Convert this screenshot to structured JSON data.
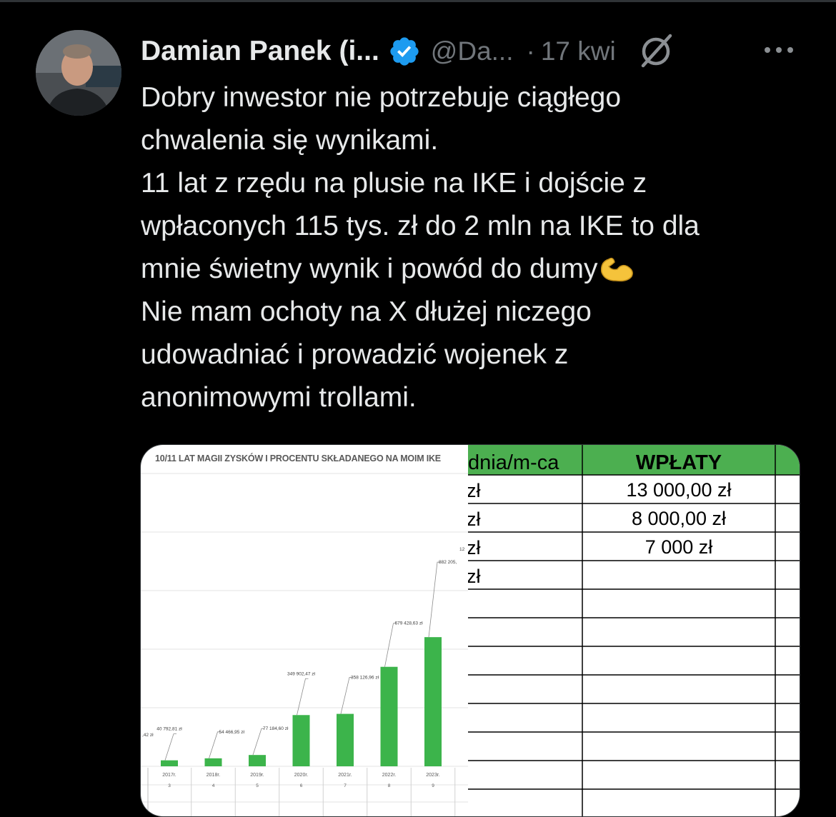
{
  "tweet": {
    "author_name": "Damian Panek (i...",
    "handle": "@Da...",
    "separator": "·",
    "timestamp": "17 kwi",
    "lines": [
      "Dobry inwestor nie potrzebuje ciągłego",
      "chwalenia się wynikami.",
      "11 lat z rzędu na plusie na IKE i dojście z",
      "wpłaconych 115 tys. zł do 2 mln na IKE to dla",
      "mnie świetny wynik i powód do dumy",
      "Nie mam ochoty na X dłużej niczego",
      "udowadniać i prowadzić wojenek z",
      "anonimowymi trollami."
    ],
    "emoji": "💪",
    "verified_color": "#1d9bf0"
  },
  "icons": {
    "verified": "verified-badge-icon",
    "grok": "grok-icon",
    "more": "more-icon"
  },
  "media": {
    "chart_title": "10/11 LAT MAGII ZYSKÓW I PROCENTU SKŁADANEGO NA MOIM IKE",
    "sheet": {
      "header_partial": "dnia/m-ca",
      "header_deposits": "WPŁATY",
      "left_col_values": [
        "zł",
        "zł",
        "zł",
        "zł"
      ],
      "deposits": [
        "13 000,00 zł",
        "8 000,00 zł",
        "7 000 zł"
      ],
      "header_color": "#4caf50"
    }
  },
  "chart_data": {
    "type": "bar",
    "title": "10/11 LAT MAGII ZYSKÓW I PROCENTU SKŁADANEGO NA MOIM IKE",
    "categories": [
      "2017r.",
      "2018r.",
      "2019r.",
      "2020r.",
      "2021r.",
      "2022r.",
      "2023r."
    ],
    "sub_labels": [
      "3",
      "4",
      "5",
      "6",
      "7",
      "8",
      "9"
    ],
    "values": [
      40792.81,
      54466.95,
      77184.6,
      349902.47,
      358126.96,
      679428.63,
      882205
    ],
    "data_labels": [
      "40 792,81 zł",
      "54 466,95 zł",
      "77 184,60 zł",
      "349 902,47 zł",
      "358 126,96 zł",
      "679 428,63 zł",
      "882 205,"
    ],
    "cut_label_left": ",42 zł",
    "cut_axis_label": "12",
    "color": "#3cb44b",
    "ylim": [
      0,
      2000000
    ],
    "grid": true
  }
}
